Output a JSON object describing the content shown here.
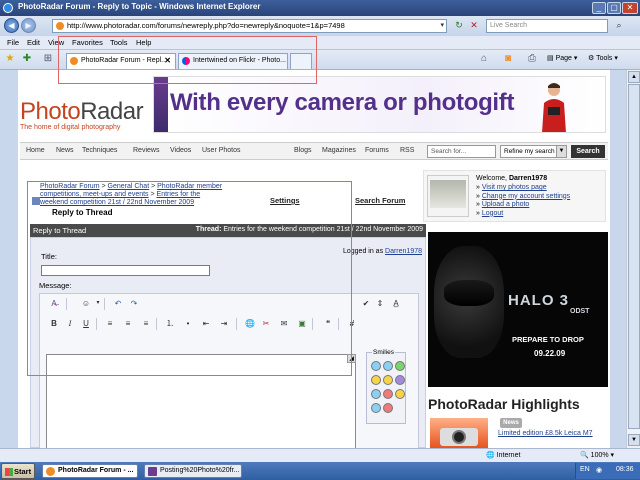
{
  "window": {
    "title": "PhotoRadar Forum - Reply to Topic - Windows Internet Explorer"
  },
  "address": {
    "url": "http://www.photoradar.com/forums/newreply.php?do=newreply&noquote=1&p=7498",
    "search_placeholder": "Live Search"
  },
  "menu": [
    "File",
    "Edit",
    "View",
    "Favorites",
    "Tools",
    "Help"
  ],
  "tabs": [
    {
      "label": "PhotoRadar Forum - Repl...",
      "active": true
    },
    {
      "label": "Intertwined on Flickr - Photo...",
      "active": false
    }
  ],
  "commandbar": {
    "page": "Page",
    "tools": "Tools"
  },
  "site": {
    "logo_photo": "Photo",
    "logo_radar": "Radar",
    "tagline": "The home of digital photography",
    "ad_text": "With every camera or photogift",
    "nav": [
      "Home",
      "News",
      "Techniques",
      "Reviews",
      "Videos",
      "User Photos",
      "Blogs",
      "Magazines",
      "Forums",
      "RSS"
    ],
    "search_placeholder": "Search for...",
    "refine_label": "Refine my search",
    "search_button": "Search"
  },
  "breadcrumb": {
    "links": [
      "PhotoRadar Forum",
      "General Chat",
      "PhotoRadar member competitions, meet-ups and events",
      "Entries for the weekend competition 21st / 22nd November 2009"
    ],
    "separator": " > ",
    "current": "Reply to Thread"
  },
  "links": {
    "settings": "Settings",
    "search_forum": "Search Forum"
  },
  "profile": {
    "welcome_prefix": "Welcome,",
    "username": "Darren1978",
    "items": [
      "Visit my photos page",
      "Change my account settings",
      "Upload a photo",
      "Logout"
    ]
  },
  "halo_ad": {
    "title": "HALO 3",
    "subtitle": "ODST",
    "cta": "PREPARE TO DROP",
    "date": "09.22.09"
  },
  "highlights": {
    "title": "PhotoRadar Highlights",
    "badge": "News",
    "link": "Limited edition £8.5k Leica M7"
  },
  "reply": {
    "header_left": "Reply to Thread",
    "thread_prefix": "Thread:",
    "thread_title": "Entries for the weekend competition 21st / 22nd November 2009",
    "logged_in_prefix": "Logged in as",
    "logged_in_user": "Darren1978",
    "title_label": "Title:",
    "message_label": "Message:",
    "smilies_label": "Smilies",
    "toolbar": {
      "bold": "B",
      "italic": "I",
      "underline": "U",
      "hash": "#"
    }
  },
  "statusbar": {
    "zone": "Internet",
    "zoom": "100%"
  },
  "taskbar": {
    "start": "Start",
    "tasks": [
      "PhotoRadar Forum - ...",
      "Posting%20Photo%20fr..."
    ],
    "lang": "EN",
    "clock": "08:36"
  },
  "colors": {
    "titlebar": "#2a4479",
    "brand_orange": "#c5441f",
    "ad_purple": "#53308a",
    "link": "#1f3f8f",
    "highlight_box": "#e06666"
  }
}
